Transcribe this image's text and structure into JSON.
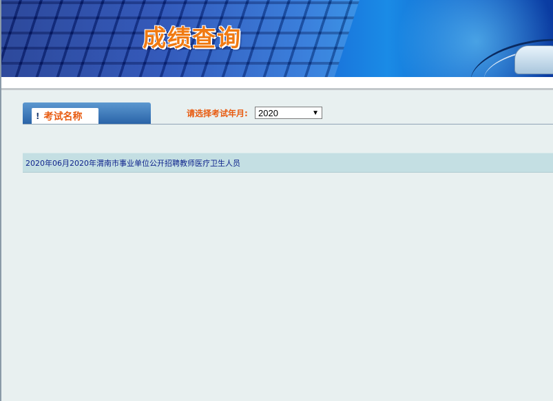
{
  "header": {
    "title": "成绩查询"
  },
  "tab": {
    "icon": "!",
    "label": "考试名称"
  },
  "filter": {
    "label": "请选择考试年月:",
    "selected_year": "2020"
  },
  "exams": [
    {
      "title": "2020年06月2020年渭南市事业单位公开招聘教师医疗卫生人员"
    }
  ],
  "colors": {
    "accent_orange": "#e85b10",
    "banner_blue": "#1a6ad6",
    "row_bg": "#c4dfe3",
    "link_blue": "#0a1f8a"
  }
}
